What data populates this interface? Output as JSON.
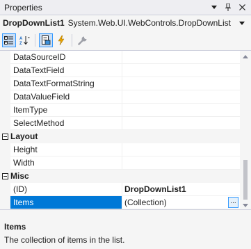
{
  "window": {
    "title": "Properties",
    "dropdown_icon": "chevron-down-icon",
    "pin_icon": "pin-icon",
    "close_icon": "close-icon"
  },
  "object_selector": {
    "name": "DropDownList1",
    "type": "System.Web.UI.WebControls.DropDownList"
  },
  "toolbar": {
    "buttons": [
      {
        "icon": "categorized-icon",
        "active": true
      },
      {
        "icon": "alphabetical-icon",
        "active": false
      },
      {
        "icon": "properties-icon",
        "active": true
      },
      {
        "icon": "events-icon",
        "active": false
      },
      {
        "icon": "property-pages-icon",
        "active": false
      }
    ]
  },
  "grid": {
    "rows": [
      {
        "type": "property",
        "name": "DataSourceID",
        "value": ""
      },
      {
        "type": "property",
        "name": "DataTextField",
        "value": ""
      },
      {
        "type": "property",
        "name": "DataTextFormatString",
        "value": ""
      },
      {
        "type": "property",
        "name": "DataValueField",
        "value": ""
      },
      {
        "type": "property",
        "name": "ItemType",
        "value": ""
      },
      {
        "type": "property",
        "name": "SelectMethod",
        "value": ""
      },
      {
        "type": "category",
        "name": "Layout"
      },
      {
        "type": "property",
        "name": "Height",
        "value": ""
      },
      {
        "type": "property",
        "name": "Width",
        "value": ""
      },
      {
        "type": "category",
        "name": "Misc"
      },
      {
        "type": "property",
        "name": "(ID)",
        "value": "DropDownList1"
      },
      {
        "type": "property",
        "name": "Items",
        "value": "(Collection)",
        "ellipsis": "..."
      }
    ]
  },
  "description": {
    "title": "Items",
    "text": "The collection of items in the list."
  },
  "colors": {
    "selection": "#0078d7",
    "category_bg": "#f5f5f5",
    "grid_bg": "#ffffff",
    "event_bolt": "#e8a200"
  }
}
